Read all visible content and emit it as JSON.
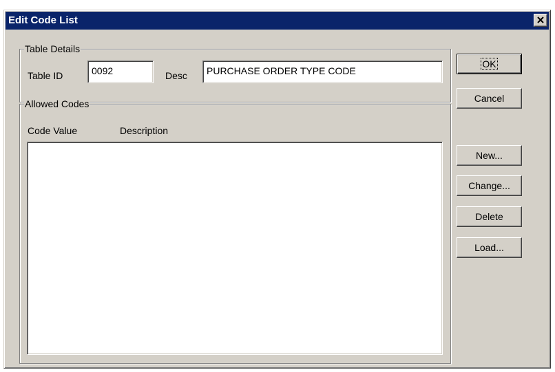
{
  "window": {
    "title": "Edit Code List",
    "close_icon": "close-x-icon"
  },
  "table_details": {
    "group_label": "Table Details",
    "table_id_label": "Table ID",
    "table_id_value": "0092",
    "desc_label": "Desc",
    "desc_value": "PURCHASE ORDER TYPE CODE"
  },
  "allowed_codes": {
    "group_label": "Allowed Codes",
    "columns": [
      "Code Value",
      "Description"
    ],
    "rows": []
  },
  "buttons": {
    "ok": "OK",
    "cancel": "Cancel",
    "new": "New...",
    "change": "Change...",
    "delete": "Delete",
    "load": "Load..."
  },
  "colors": {
    "title_bar": "#0a246a",
    "face": "#d4d0c8"
  }
}
